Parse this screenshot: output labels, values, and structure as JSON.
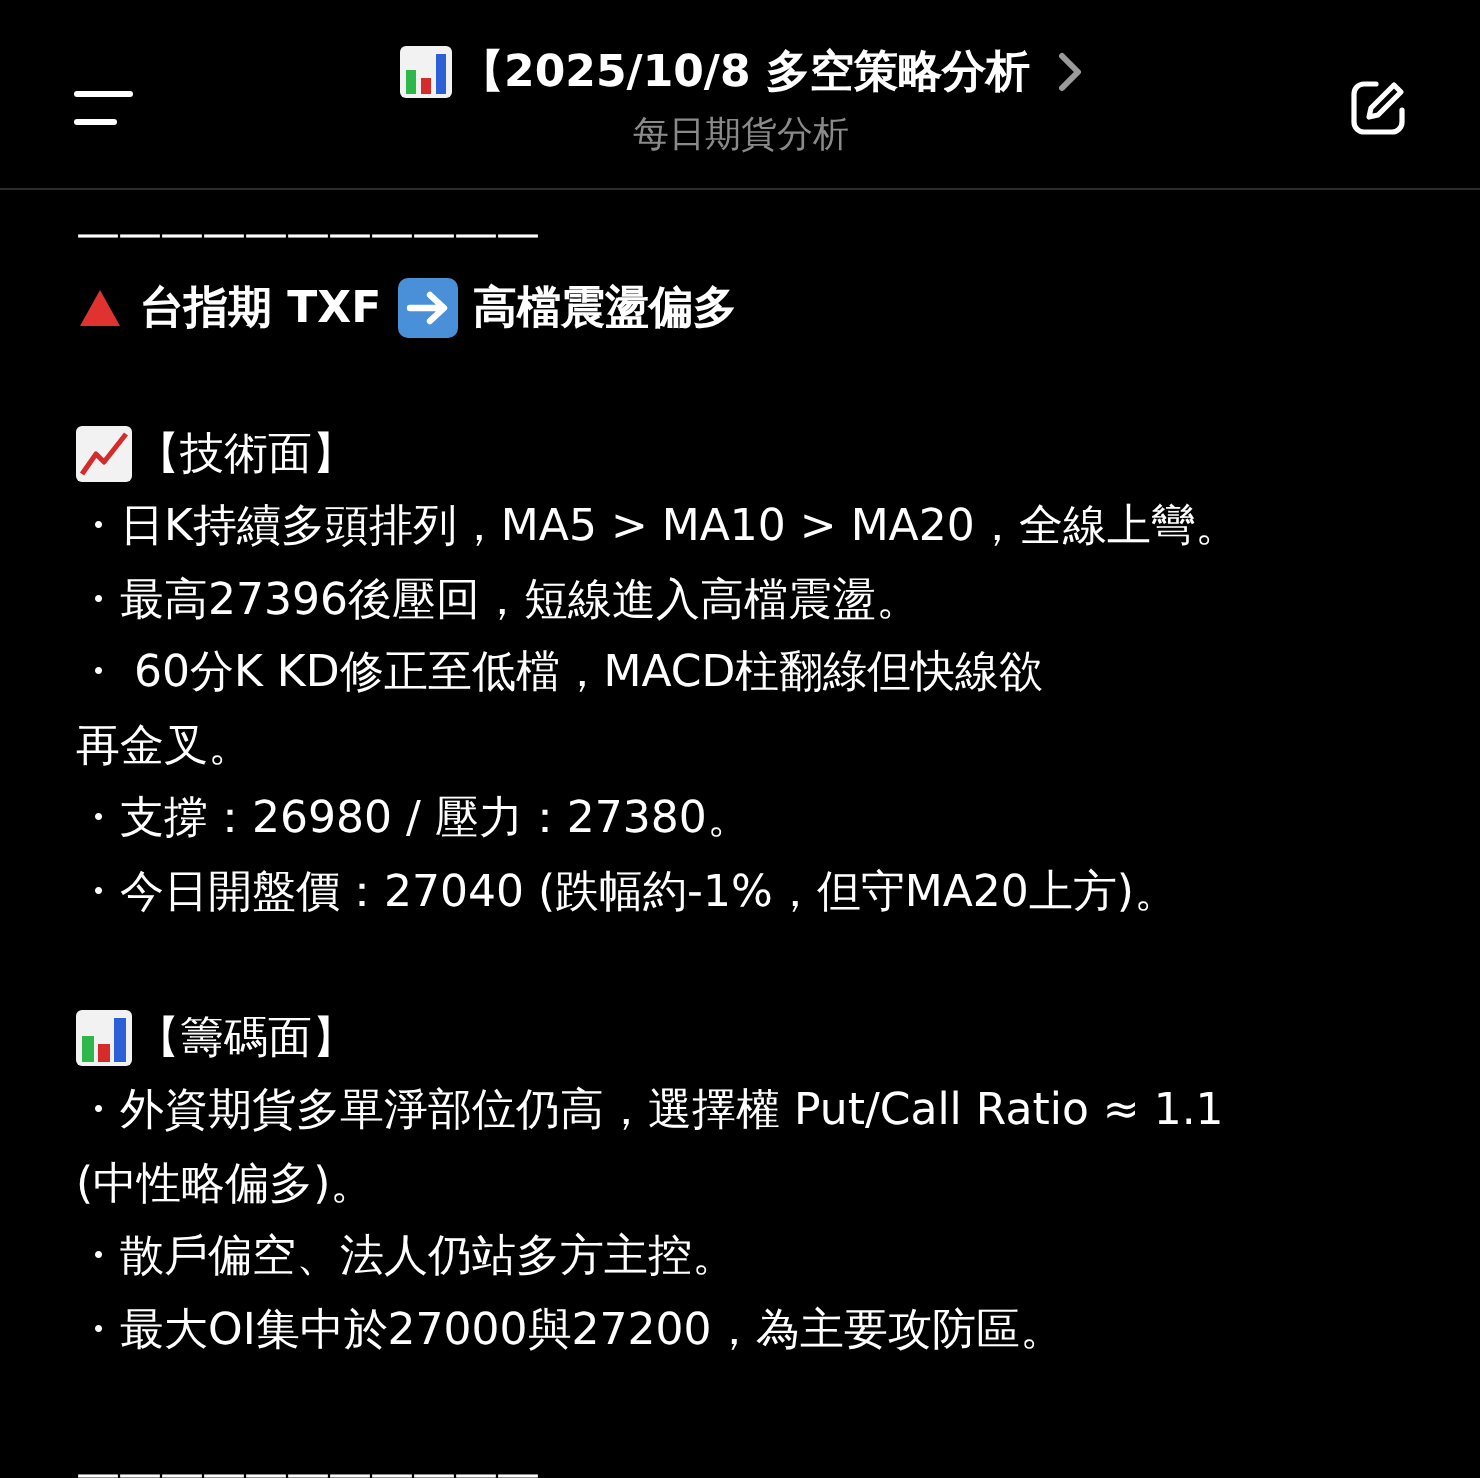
{
  "header": {
    "title": "【2025/10/8 多空策略分析",
    "subtitle": "每日期貨分析"
  },
  "lines": [
    {
      "kind": "divider",
      "text": "———————————"
    },
    {
      "kind": "headline",
      "parts": [
        "台指期 TXF",
        "高檔震盪偏多"
      ]
    },
    {
      "kind": "blank"
    },
    {
      "kind": "trend_section",
      "text": "【技術面】"
    },
    {
      "kind": "text",
      "text": "・日K持續多頭排列，MA5 > MA10 > MA20，全線上彎。"
    },
    {
      "kind": "text",
      "text": "・最高27396後壓回，短線進入高檔震盪。"
    },
    {
      "kind": "text",
      "text": "・ 60分K KD修正至低檔，MACD柱翻綠但快線欲"
    },
    {
      "kind": "text",
      "text": "再金叉。"
    },
    {
      "kind": "text",
      "text": "・支撐：26980 / 壓力：27380。"
    },
    {
      "kind": "text",
      "text": "・今日開盤價：27040 (跌幅約-1%，但守MA20上方)。"
    },
    {
      "kind": "blank"
    },
    {
      "kind": "bars_section",
      "text": "【籌碼面】"
    },
    {
      "kind": "text",
      "text": "・外資期貨多單淨部位仍高，選擇權 Put/Call Ratio ≈ 1.1"
    },
    {
      "kind": "text",
      "text": "(中性略偏多)。"
    },
    {
      "kind": "text",
      "text": "・散戶偏空、法人仍站多方主控。"
    },
    {
      "kind": "text",
      "text": "・最大OI集中於27000與27200，為主要攻防區。"
    },
    {
      "kind": "blank"
    },
    {
      "kind": "divider",
      "text": "———————————"
    }
  ]
}
